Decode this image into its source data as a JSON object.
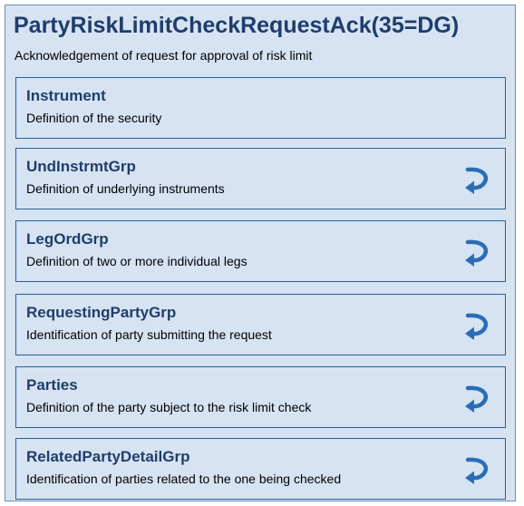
{
  "message": {
    "title": "PartyRiskLimitCheckRequestAck(35=DG)",
    "description": "Acknowledgement of request for approval of risk limit"
  },
  "components": [
    {
      "name": "Instrument",
      "description": "Definition of the security",
      "repeating": false
    },
    {
      "name": "UndInstrmtGrp",
      "description": "Definition of underlying instruments",
      "repeating": true,
      "icon": "repeat-arrow-icon"
    },
    {
      "name": "LegOrdGrp",
      "description": "Definition of two or more individual legs",
      "repeating": true,
      "icon": "repeat-arrow-icon"
    },
    {
      "name": "RequestingPartyGrp",
      "description": "Identification of party submitting the request",
      "repeating": true,
      "icon": "repeat-arrow-icon"
    },
    {
      "name": "Parties",
      "description": "Definition of the party subject to the risk limit check",
      "repeating": true,
      "icon": "repeat-arrow-icon"
    },
    {
      "name": "RelatedPartyDetailGrp",
      "description": "Identification of parties related to the one being checked",
      "repeating": true,
      "icon": "repeat-arrow-icon"
    }
  ],
  "colors": {
    "background": "#d6e3f2",
    "border": "#2e5f96",
    "title_text": "#1f3d6b",
    "icon": "#2a6db5"
  }
}
